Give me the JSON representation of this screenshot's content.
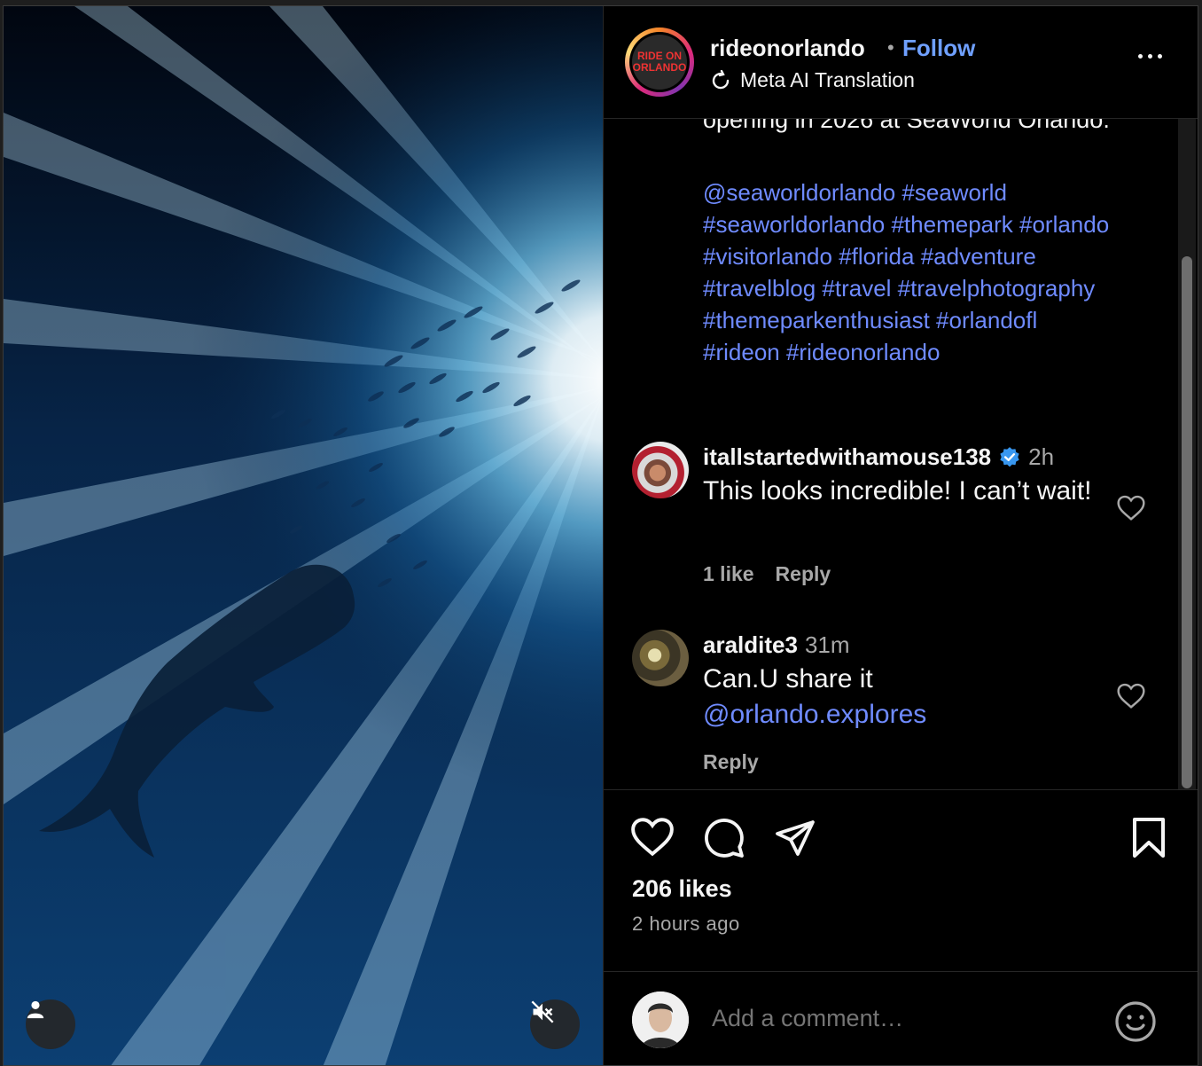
{
  "header": {
    "username": "rideonorlando",
    "separator": "•",
    "follow_label": "Follow",
    "translation_label": "Meta AI Translation",
    "avatar_text": "RIDE ON ORLANDO"
  },
  "caption": {
    "partial_line": "opening in 2026 at SeaWorld Orlando.",
    "hashtags": "@seaworldorlando #seaworld #seaworldorlando #themepark #orlando #visitorlando #florida #adventure #travelblog #travel #travelphotography #themeparkenthusiast #orlandofl #rideon #rideonorlando"
  },
  "comments": [
    {
      "username": "itallstartedwithamouse138",
      "verified": true,
      "time": "2h",
      "text": "This looks incredible! I can’t wait!",
      "likes": "1 like",
      "reply_label": "Reply"
    },
    {
      "username": "araldite3",
      "verified": false,
      "time": "31m",
      "text_prefix": "Can.U share it",
      "mention": "@orlando.explores",
      "reply_label": "Reply"
    }
  ],
  "actions": {
    "likes": "206 likes",
    "posted_ago": "2 hours ago"
  },
  "add_comment": {
    "placeholder": "Add a comment…"
  },
  "colors": {
    "accent_link": "#6f8bff",
    "follow": "#6fa0ff",
    "verified": "#3897f0",
    "background": "#000000"
  },
  "icons": [
    "profile-icon",
    "mute-icon",
    "refresh-icon",
    "more-icon",
    "verified-icon",
    "heart-icon",
    "comment-icon",
    "share-icon",
    "bookmark-icon",
    "emoji-icon"
  ]
}
